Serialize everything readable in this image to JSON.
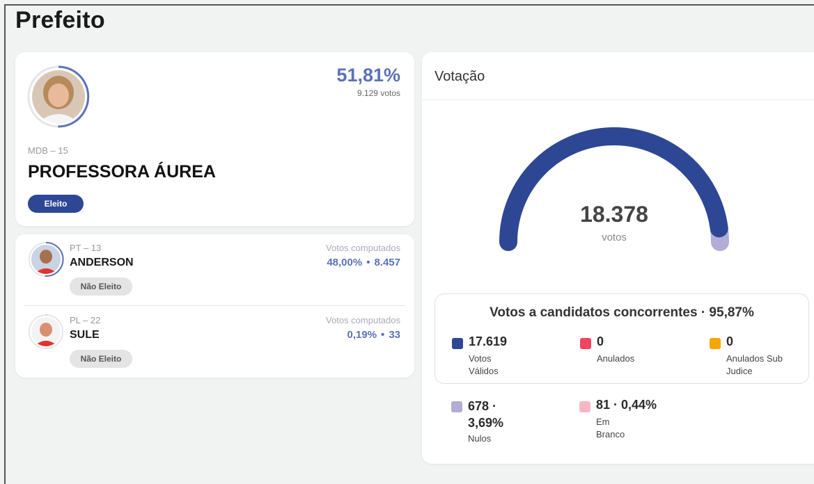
{
  "page_title": "Prefeito",
  "winner": {
    "percent": "51,81%",
    "votes": "9.129 votos",
    "party": "MDB – 15",
    "name": "PROFESSORA ÁUREA",
    "badge": "Eleito"
  },
  "others": [
    {
      "party": "PT – 13",
      "name": "ANDERSON",
      "badge": "Não Eleito",
      "votes_label": "Votos computados",
      "percent": "48,00%",
      "votes": "8.457"
    },
    {
      "party": "PL – 22",
      "name": "SULE",
      "badge": "Não Eleito",
      "votes_label": "Votos computados",
      "percent": "0,19%",
      "votes": "33"
    }
  ],
  "votacao": {
    "title": "Votação",
    "total": "18.378",
    "unit": "votos",
    "gauge_valid_fraction": 0.9587,
    "box_title": "Votos a candidatos concorrentes · 95,87%",
    "stats": [
      {
        "value": "17.619",
        "label": "Votos Válidos",
        "color": "#2e4795"
      },
      {
        "value": "0",
        "label": "Anulados",
        "color": "#f0455f"
      },
      {
        "value": "0",
        "label": "Anulados Sub Judice",
        "color": "#f7a600"
      },
      {
        "value": "678 · 3,69%",
        "label": "Nulos",
        "color": "#b3acd6"
      },
      {
        "value": "81 · 0,44%",
        "label": "Em Branco",
        "color": "#f7b6c2"
      }
    ]
  },
  "colors": {
    "accent": "#5b72b8",
    "gauge_main": "#2e4795",
    "gauge_rest": "#b3acd6",
    "badge_elected": "#2e4795"
  }
}
